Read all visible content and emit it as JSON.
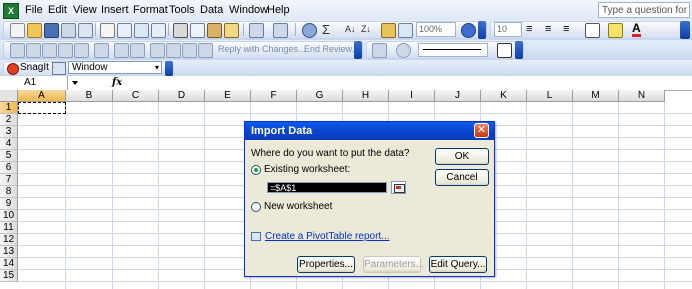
{
  "menu": {
    "items": [
      {
        "label": "File"
      },
      {
        "label": "Edit"
      },
      {
        "label": "View"
      },
      {
        "label": "Insert"
      },
      {
        "label": "Format"
      },
      {
        "label": "Tools"
      },
      {
        "label": "Data"
      },
      {
        "label": "Window"
      },
      {
        "label": "Help"
      }
    ],
    "help_placeholder": "Type a question for help"
  },
  "toolbar": {
    "zoom": "100%",
    "font_size": "10",
    "reply_with_changes": "Reply with Changes...",
    "end_review": "End Review...",
    "snagit_label": "SnagIt",
    "capture_mode": "Window"
  },
  "formula_bar": {
    "name_box": "A1",
    "fx": "fx",
    "content": ""
  },
  "grid": {
    "columns": [
      "A",
      "B",
      "C",
      "D",
      "E",
      "F",
      "G",
      "H",
      "I",
      "J",
      "K",
      "L",
      "M",
      "N"
    ],
    "rows": [
      "1",
      "2",
      "3",
      "4",
      "5",
      "6",
      "7",
      "8",
      "9",
      "10",
      "11",
      "12",
      "13",
      "14",
      "15"
    ],
    "active_cell": "A1"
  },
  "dialog": {
    "title": "Import Data",
    "prompt": "Where do you want to put the data?",
    "existing_label": "Existing worksheet:",
    "existing_value": "=$A$1",
    "new_label": "New worksheet",
    "pivot_link": "Create a PivotTable report...",
    "ok_label": "OK",
    "cancel_label": "Cancel",
    "properties_label": "Properties...",
    "parameters_label": "Parameters...",
    "edit_query_label": "Edit Query...",
    "selected_option": "existing"
  }
}
